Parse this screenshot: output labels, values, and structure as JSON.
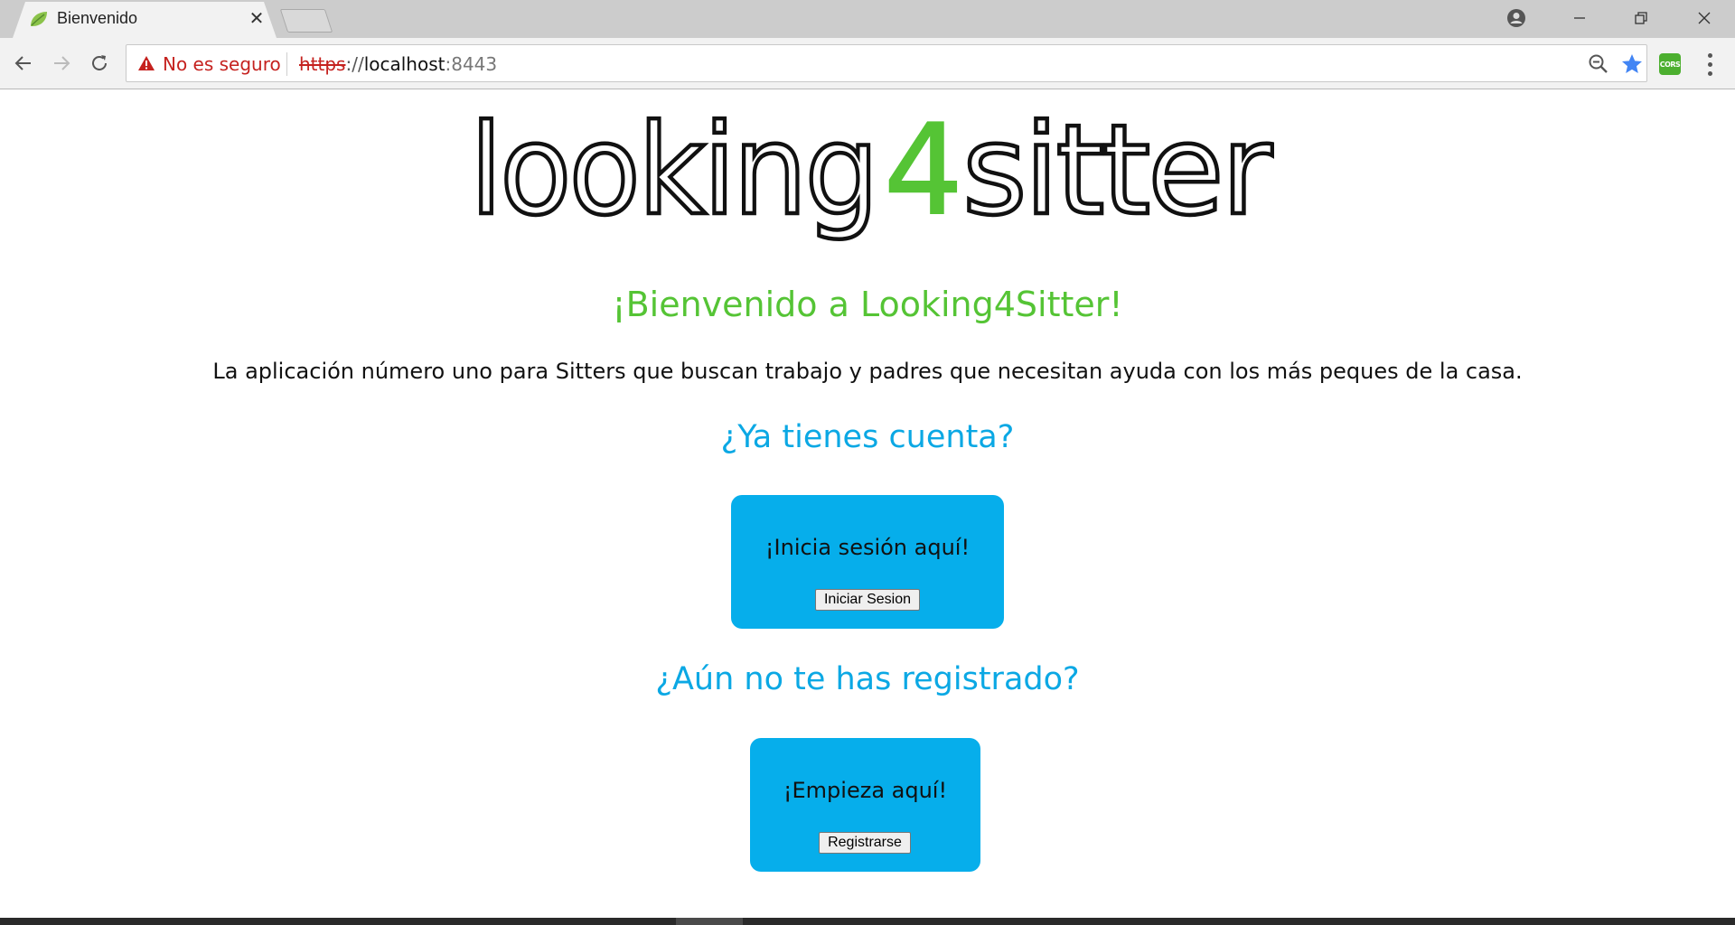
{
  "browser": {
    "tab_title": "Bienvenido",
    "security_label": "No es seguro",
    "url": {
      "scheme": "https",
      "separator": "://",
      "host": "localhost",
      "port": ":8443"
    },
    "extension_label": "CORS"
  },
  "page": {
    "logo_text": "looking4sitter",
    "welcome": "¡Bienvenido a Looking4Sitter!",
    "intro": "La aplicación número uno para Sitters que buscan trabajo y padres que necesitan ayuda con los más peques de la casa.",
    "login_section": {
      "heading": "¿Ya tienes cuenta?",
      "card_text": "¡Inicia sesión aquí!",
      "button": "Iniciar Sesion"
    },
    "register_section": {
      "heading": "¿Aún no te has registrado?",
      "card_text": "¡Empieza aquí!",
      "button": "Registrarse"
    }
  },
  "colors": {
    "brand_green": "#55c435",
    "accent_blue": "#0ba8e4",
    "card_blue": "#06aeeb",
    "warning_red": "#c5221f"
  },
  "icons": [
    "leaf-favicon-icon",
    "close-icon",
    "profile-icon",
    "minimize-icon",
    "restore-icon",
    "close-window-icon",
    "back-arrow-icon",
    "forward-arrow-icon",
    "reload-icon",
    "warning-icon",
    "zoom-out-icon",
    "star-icon",
    "cors-extension-icon",
    "menu-icon"
  ]
}
